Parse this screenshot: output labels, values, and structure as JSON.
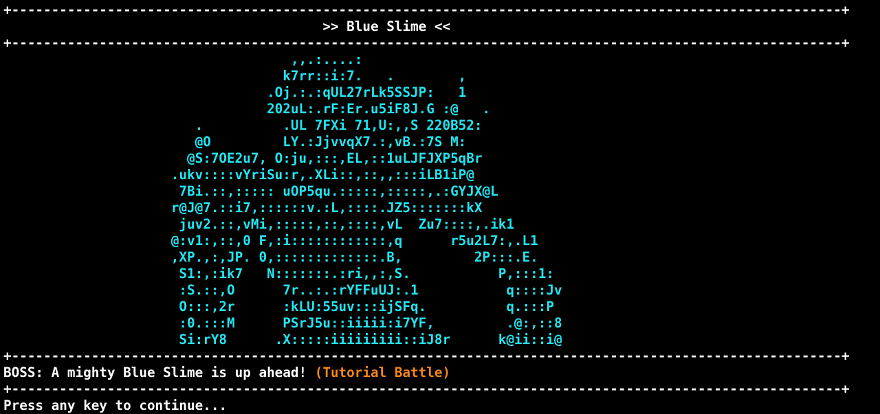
{
  "screen": {
    "kind": "terminal-boss-encounter",
    "columns": 110,
    "rows": 25,
    "background_color": "#000000",
    "default_text_color": "#ffffff",
    "art_color": "#22e5f0",
    "accent_color": "#f2861b"
  },
  "header": {
    "top_border": "+--------------------------------------------------------------------------------------------------------+",
    "title": "                                        >> Blue Slime <<",
    "title_text": ">> Blue Slime <<",
    "bottom_border": "+--------------------------------------------------------------------------------------------------------+"
  },
  "art": {
    "name": "blue-slime-ascii-sprite",
    "color": "#22e5f0",
    "lines": [
      "                                    ,,.:....:",
      "                                   k7rr::i:7.   .        ,",
      "                                 .Oj.:.:qUL27rLk5SSJP:   1",
      "                                 202uL:.rF:Er.u5iF8J.G :@   .",
      "                        .          .UL 7FXi 71,U:,,S 220B52:",
      "                        @O         LY.:JjvvqX7.:,vB.:7S M:",
      "                       @S:7OE2u7, O:ju,:::,EL,::1uLJFJXP5qBr",
      "                     .ukv::::vYriSu:r,.XLi::,::,,:::iLB1iP@",
      "                      7Bi.::,::::: uOP5qu.:::::,:::::,.:GYJX@L",
      "                     r@J@7.::i7,::::::v.:L,::::.JZ5:::::::kX",
      "                      juv2.::,vMi,:::::,::,::::,vL  Zu7::::,.ik1",
      "                     @:v1:,::,0 F,:i::::::::::::,q      r5u2L7:,.L1",
      "                     ,XP.,:,JP. 0,:::::::::::::.B,         2P:::.E.",
      "                      S1:,:ik7   N:::::::.:ri,,:,S.           P,:::1:",
      "                      :S.::,O      7r..:.:rYFFuUJ:.1           q::::Jv",
      "                      O:::,2r      :kLU:55uv:::ijSFq.          q.:::P",
      "                      :0.:::M      PSrJ5u::iiiii:i7YF,         .@:,::8",
      "                      Si:rY8      .X:::::iiiiiiiii::iJ8r      k@ii::i@"
    ]
  },
  "message_box": {
    "top_border": "+--------------------------------------------------------------------------------------------------------+",
    "label": "BOSS:",
    "text": "BOSS: A mighty Blue Slime is up ahead! ",
    "tag": "(Tutorial Battle)",
    "bottom_border": "+--------------------------------------------------------------------------------------------------------+"
  },
  "footer": {
    "prompt": "Press any key to continue..."
  }
}
